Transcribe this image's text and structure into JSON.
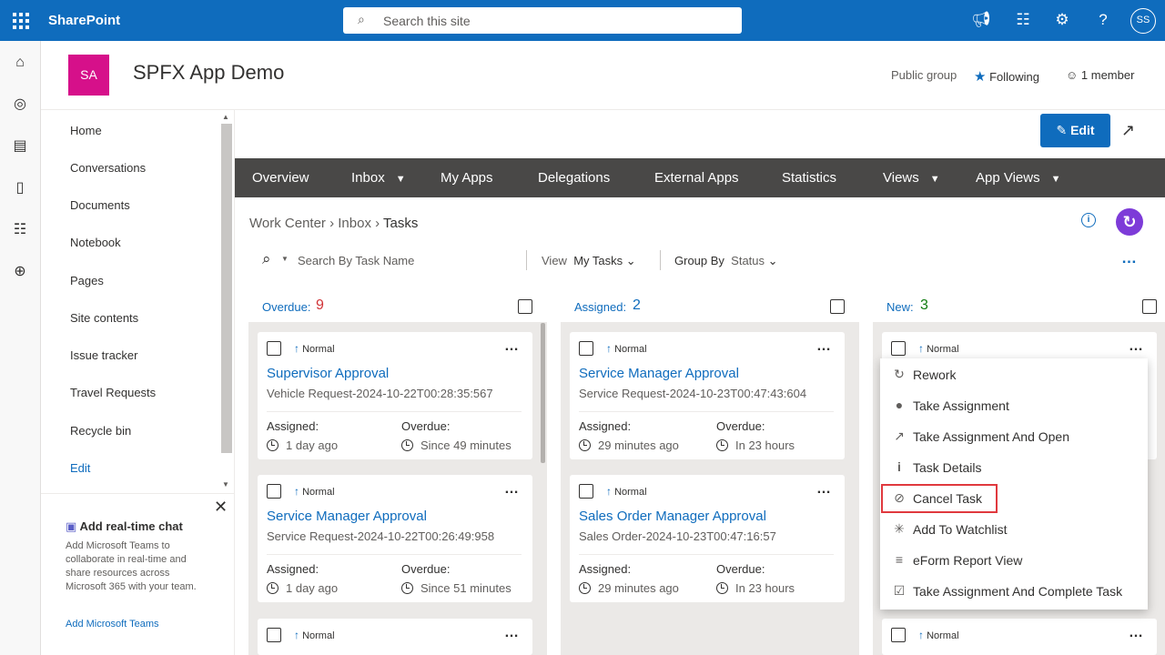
{
  "topbar": {
    "brand": "SharePoint",
    "search_placeholder": "Search this site",
    "avatar_initials": "SS"
  },
  "site": {
    "logo_initials": "SA",
    "title": "SPFX App Demo",
    "visibility": "Public group",
    "following_label": "Following",
    "members_label": "1 member"
  },
  "leftnav": {
    "items": [
      "Home",
      "Conversations",
      "Documents",
      "Notebook",
      "Pages",
      "Site contents",
      "Issue tracker",
      "Travel Requests",
      "Recycle bin"
    ],
    "edit_label": "Edit"
  },
  "chat": {
    "title": "Add real-time chat",
    "body": "Add Microsoft Teams to collaborate in real-time and share resources across Microsoft 365 with your team.",
    "link": "Add Microsoft Teams"
  },
  "commandbar": {
    "edit_label": "Edit"
  },
  "menubar": {
    "items": [
      "Overview",
      "Inbox",
      "My Apps",
      "Delegations",
      "External Apps",
      "Statistics",
      "Views",
      "App Views"
    ]
  },
  "breadcrumb": {
    "items": [
      "Work Center",
      "Inbox",
      "Tasks"
    ]
  },
  "toolbar": {
    "search_placeholder": "Search By Task Name",
    "view_label": "View",
    "view_value": "My Tasks",
    "group_label": "Group By",
    "group_value": "Status"
  },
  "columns": [
    {
      "label": "Overdue:",
      "count": "9",
      "count_color": "#d13438"
    },
    {
      "label": "Assigned:",
      "count": "2",
      "count_color": "#0f6cbd"
    },
    {
      "label": "New:",
      "count": "3",
      "count_color": "#107c10"
    }
  ],
  "cards": {
    "c1": {
      "priority": "Normal",
      "title": "Supervisor Approval",
      "subtitle": "Vehicle Request-2024-10-22T00:28:35:567",
      "assigned_label": "Assigned:",
      "assigned_value": "1 day ago",
      "overdue_label": "Overdue:",
      "overdue_value": "Since 49 minutes"
    },
    "c2": {
      "priority": "Normal",
      "title": "Service Manager Approval",
      "subtitle": "Service Request-2024-10-22T00:26:49:958",
      "assigned_label": "Assigned:",
      "assigned_value": "1 day ago",
      "overdue_label": "Overdue:",
      "overdue_value": "Since 51 minutes"
    },
    "c3": {
      "priority": "Normal"
    },
    "c4": {
      "priority": "Normal",
      "title": "Service Manager Approval",
      "subtitle": "Service Request-2024-10-23T00:47:43:604",
      "assigned_label": "Assigned:",
      "assigned_value": "29 minutes ago",
      "overdue_label": "Overdue:",
      "overdue_value": "In 23 hours"
    },
    "c5": {
      "priority": "Normal",
      "title": "Sales Order Manager Approval",
      "subtitle": "Sales Order-2024-10-23T00:47:16:57",
      "assigned_label": "Assigned:",
      "assigned_value": "29 minutes ago",
      "overdue_label": "Overdue:",
      "overdue_value": "In 23 hours"
    },
    "c6": {
      "priority": "Normal"
    },
    "c7": {
      "priority": "Normal"
    }
  },
  "context_menu": {
    "items": [
      "Rework",
      "Take Assignment",
      "Take Assignment And Open",
      "Task Details",
      "Cancel Task",
      "Add To Watchlist",
      "eForm Report View",
      "Take Assignment And Complete Task"
    ]
  }
}
